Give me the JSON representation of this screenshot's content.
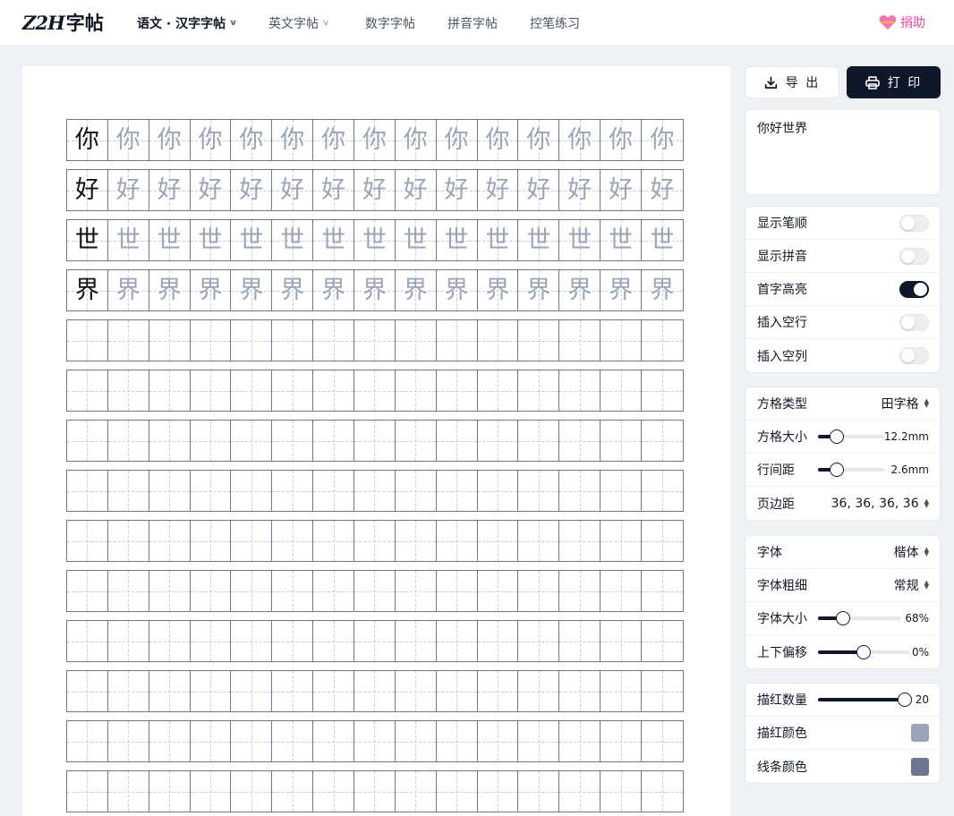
{
  "header": {
    "logo_latin": "Z2H",
    "logo_cjk": "字帖",
    "nav": [
      {
        "label": "语文 · 汉字字帖",
        "dropdown": true,
        "active": true
      },
      {
        "label": "英文字帖",
        "dropdown": true,
        "active": false
      },
      {
        "label": "数字字帖",
        "dropdown": false,
        "active": false
      },
      {
        "label": "拼音字帖",
        "dropdown": false,
        "active": false
      },
      {
        "label": "控笔练习",
        "dropdown": false,
        "active": false
      }
    ],
    "donate_label": "捐助"
  },
  "actions": {
    "export_label": "导 出",
    "print_label": "打 印"
  },
  "text_input": {
    "value": "你好世界"
  },
  "toggles": [
    {
      "label": "显示笔顺",
      "on": false
    },
    {
      "label": "显示拼音",
      "on": false
    },
    {
      "label": "首字高亮",
      "on": true
    },
    {
      "label": "插入空行",
      "on": false
    },
    {
      "label": "插入空列",
      "on": false
    }
  ],
  "grid_settings": {
    "type_label": "方格类型",
    "type_value": "田字格",
    "size_label": "方格大小",
    "size_value": "12.2mm",
    "size_fraction": 0.28,
    "line_gap_label": "行间距",
    "line_gap_value": "2.6mm",
    "line_gap_fraction": 0.28,
    "margin_label": "页边距",
    "margin_value": "36, 36, 36, 36"
  },
  "font_settings": {
    "font_label": "字体",
    "font_value": "楷体",
    "weight_label": "字体粗细",
    "weight_value": "常规",
    "size_label": "字体大小",
    "size_value": "68%",
    "size_fraction": 0.3,
    "offset_label": "上下偏移",
    "offset_value": "0%",
    "offset_fraction": 0.5
  },
  "trace_settings": {
    "count_label": "描红数量",
    "count_value": "20",
    "count_fraction": 1.0,
    "trace_color_label": "描红颜色",
    "trace_color": "#9aa5b8",
    "line_color_label": "线条颜色",
    "line_color": "#6b7790"
  },
  "worksheet": {
    "characters": [
      "你",
      "好",
      "世",
      "界"
    ],
    "columns": 15,
    "empty_rows": 10
  }
}
